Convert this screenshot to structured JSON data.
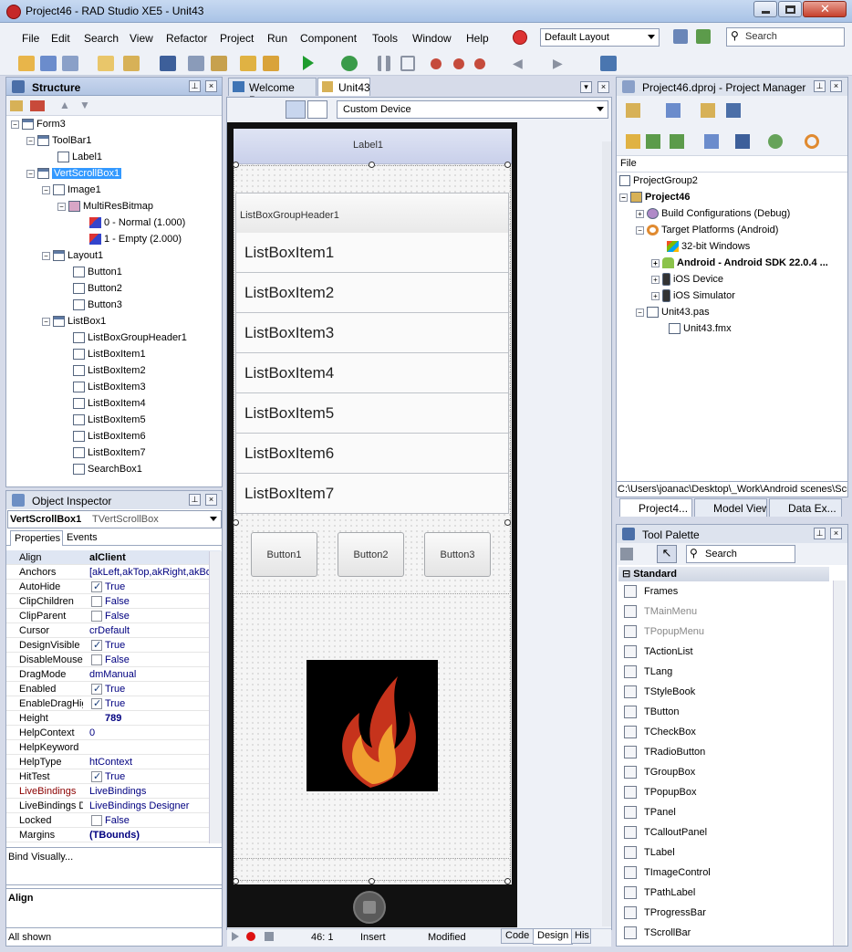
{
  "window": {
    "title": "Project46 - RAD Studio XE5 - Unit43"
  },
  "menu": [
    "File",
    "Edit",
    "Search",
    "View",
    "Refactor",
    "Project",
    "Run",
    "Component",
    "Tools",
    "Window",
    "Help"
  ],
  "layout_combo": "Default Layout",
  "search_placeholder": "Search",
  "structure": {
    "title": "Structure",
    "nodes": [
      {
        "label": "Form3"
      },
      {
        "label": "ToolBar1"
      },
      {
        "label": "Label1"
      },
      {
        "label": "VertScrollBox1"
      },
      {
        "label": "Image1"
      },
      {
        "label": "MultiResBitmap"
      },
      {
        "label": "0 - Normal (1.000)"
      },
      {
        "label": "1 - Empty (2.000)"
      },
      {
        "label": "Layout1"
      },
      {
        "label": "Button1"
      },
      {
        "label": "Button2"
      },
      {
        "label": "Button3"
      },
      {
        "label": "ListBox1"
      },
      {
        "label": "ListBoxGroupHeader1"
      },
      {
        "label": "ListBoxItem1"
      },
      {
        "label": "ListBoxItem2"
      },
      {
        "label": "ListBoxItem3"
      },
      {
        "label": "ListBoxItem4"
      },
      {
        "label": "ListBoxItem5"
      },
      {
        "label": "ListBoxItem6"
      },
      {
        "label": "ListBoxItem7"
      },
      {
        "label": "SearchBox1"
      }
    ]
  },
  "inspector": {
    "title": "Object Inspector",
    "object": "VertScrollBox1",
    "object_type": "TVertScrollBox",
    "tabs": [
      "Properties",
      "Events"
    ],
    "props": [
      {
        "name": "Align",
        "value": "alClient",
        "check": null
      },
      {
        "name": "Anchors",
        "value": "[akLeft,akTop,akRight,akBo",
        "check": null
      },
      {
        "name": "AutoHide",
        "value": "True",
        "check": true
      },
      {
        "name": "ClipChildren",
        "value": "False",
        "check": false
      },
      {
        "name": "ClipParent",
        "value": "False",
        "check": false
      },
      {
        "name": "Cursor",
        "value": "crDefault",
        "check": null
      },
      {
        "name": "DesignVisible",
        "value": "True",
        "check": true
      },
      {
        "name": "DisableMouseW",
        "value": "False",
        "check": false
      },
      {
        "name": "DragMode",
        "value": "dmManual",
        "check": null
      },
      {
        "name": "Enabled",
        "value": "True",
        "check": true
      },
      {
        "name": "EnableDragHig",
        "value": "True",
        "check": true
      },
      {
        "name": "Height",
        "value": "789",
        "check": null
      },
      {
        "name": "HelpContext",
        "value": "0",
        "check": null
      },
      {
        "name": "HelpKeyword",
        "value": "",
        "check": null
      },
      {
        "name": "HelpType",
        "value": "htContext",
        "check": null
      },
      {
        "name": "HitTest",
        "value": "True",
        "check": true
      },
      {
        "name": "LiveBindings",
        "value": "LiveBindings",
        "check": null
      },
      {
        "name": "LiveBindings D",
        "value": "LiveBindings Designer",
        "check": null
      },
      {
        "name": "Locked",
        "value": "False",
        "check": false
      },
      {
        "name": "Margins",
        "value": "(TBounds)",
        "check": null
      }
    ],
    "bind_visually": "Bind Visually...",
    "help_title": "Align",
    "all_shown": "All shown"
  },
  "designer": {
    "tabs": [
      "Welcome Page",
      "Unit43"
    ],
    "device": "Custom Device",
    "label1": "Label1",
    "group_header": "ListBoxGroupHeader1",
    "list_items": [
      "ListBoxItem1",
      "ListBoxItem2",
      "ListBoxItem3",
      "ListBoxItem4",
      "ListBoxItem5",
      "ListBoxItem6",
      "ListBoxItem7"
    ],
    "buttons": [
      "Button1",
      "Button2",
      "Button3"
    ],
    "status": {
      "position": "46:  1",
      "mode": "Insert",
      "state": "Modified"
    },
    "bottom_tabs": [
      "Code",
      "Design",
      "His"
    ]
  },
  "project_manager": {
    "title": "Project46.dproj - Project Manager",
    "file_header": "File",
    "items": [
      {
        "label": "ProjectGroup2"
      },
      {
        "label": "Project46"
      },
      {
        "label": "Build Configurations (Debug)"
      },
      {
        "label": "Target Platforms (Android)"
      },
      {
        "label": "32-bit Windows"
      },
      {
        "label": "Android - Android SDK 22.0.4 ..."
      },
      {
        "label": "iOS Device"
      },
      {
        "label": "iOS Simulator"
      },
      {
        "label": "Unit43.pas"
      },
      {
        "label": "Unit43.fmx"
      }
    ],
    "path": "C:\\Users\\joanac\\Desktop\\_Work\\Android scenes\\Scr",
    "tabs": [
      "Project4...",
      "Model View",
      "Data Ex..."
    ]
  },
  "tool_palette": {
    "title": "Tool Palette",
    "search_placeholder": "Search",
    "category": "Standard",
    "items": [
      "Frames",
      "TMainMenu",
      "TPopupMenu",
      "TActionList",
      "TLang",
      "TStyleBook",
      "TButton",
      "TCheckBox",
      "TRadioButton",
      "TGroupBox",
      "TPopupBox",
      "TPanel",
      "TCalloutPanel",
      "TLabel",
      "TImageControl",
      "TPathLabel",
      "TProgressBar",
      "TScrollBar"
    ]
  }
}
